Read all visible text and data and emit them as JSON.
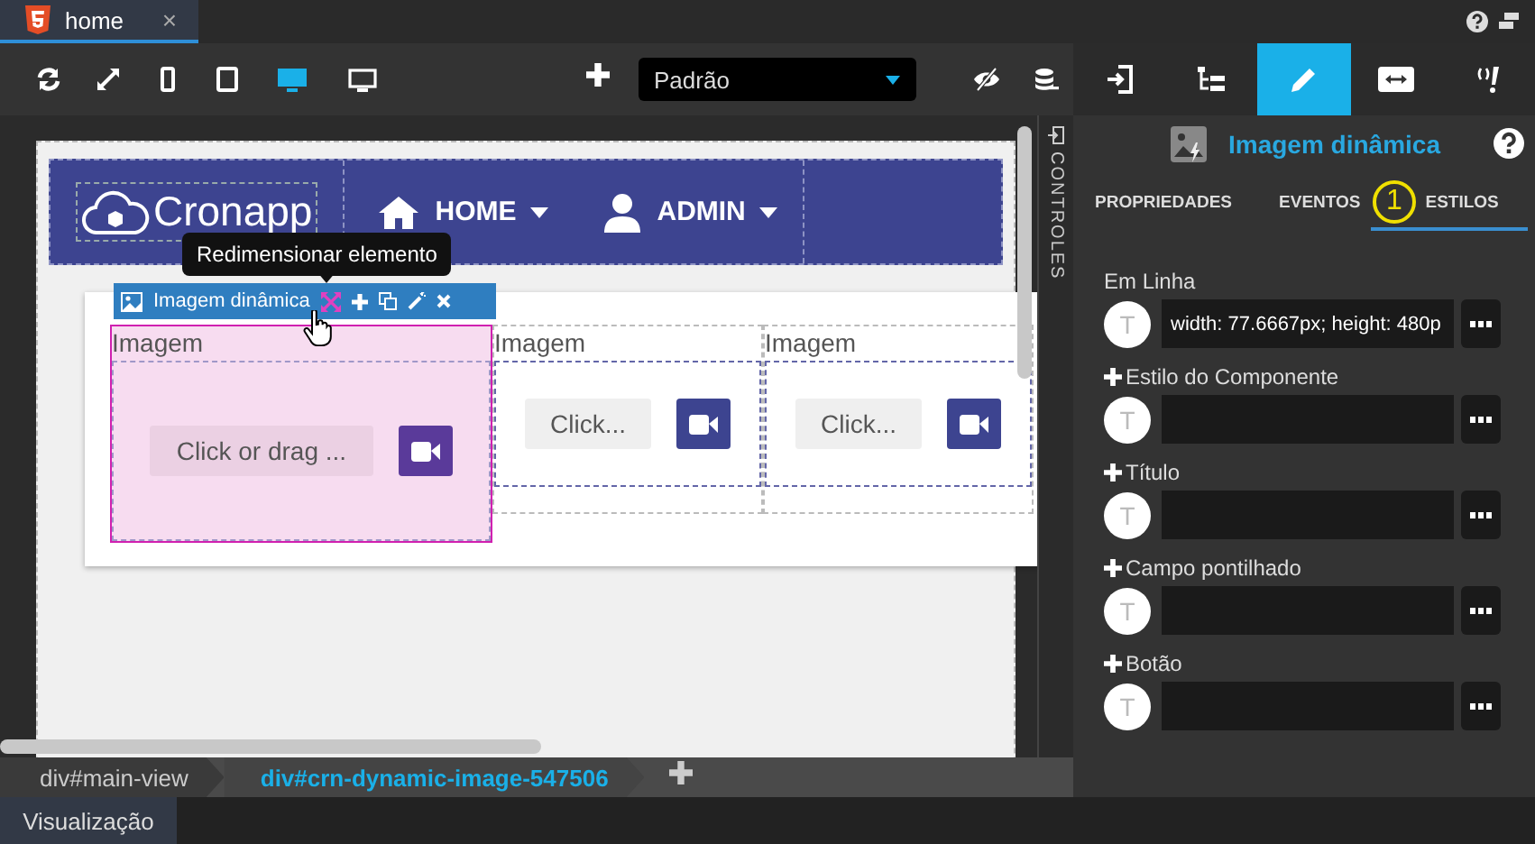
{
  "editor_tab": {
    "label": "home",
    "close": "×"
  },
  "toolbar": {
    "view_modes": [
      {
        "selected": false
      },
      {
        "selected": false
      },
      {
        "selected": true
      },
      {
        "selected": false
      }
    ],
    "theme_select": {
      "value": "Padrão"
    }
  },
  "canvas": {
    "brand": "Cronapp",
    "nav_items": [
      {
        "label": "HOME",
        "kind": "home"
      },
      {
        "label": "ADMIN",
        "kind": "user"
      }
    ],
    "tooltip": "Redimensionar elemento",
    "component_toolbar": {
      "title": "Imagem dinâmica"
    },
    "images": [
      {
        "label": "Imagem",
        "button_text": "Click or drag ...",
        "selected": true
      },
      {
        "label": "Imagem",
        "button_text": "Click...",
        "selected": false
      },
      {
        "label": "Imagem",
        "button_text": "Click...",
        "selected": false
      }
    ]
  },
  "side_strip": {
    "label": "CONTROLES"
  },
  "breadcrumbs": [
    {
      "label": "div#main-view",
      "selected": false
    },
    {
      "label": "div#crn-dynamic-image-547506",
      "selected": true
    }
  ],
  "bottom_tab": {
    "label": "Visualização"
  },
  "panel": {
    "tabs": [
      {
        "selected": false
      },
      {
        "selected": false
      },
      {
        "selected": true
      },
      {
        "selected": false
      },
      {
        "selected": false
      }
    ],
    "title": "Imagem dinâmica",
    "sub_tabs": [
      {
        "label": "PROPRIEDADES",
        "selected": false
      },
      {
        "label": "EVENTOS",
        "selected": false
      },
      {
        "label": "ESTILOS",
        "selected": true
      }
    ],
    "annotation": "1",
    "style_fields": [
      {
        "label": "Em Linha",
        "expandable": false,
        "avatar": "T",
        "value": "width: 77.6667px; height: 480p"
      },
      {
        "label": "Estilo do Componente",
        "expandable": true,
        "avatar": "T"
      },
      {
        "label": "Título",
        "expandable": true,
        "avatar": "T"
      },
      {
        "label": "Campo pontilhado",
        "expandable": true,
        "avatar": "T"
      },
      {
        "label": "Botão",
        "expandable": true,
        "avatar": "T"
      }
    ]
  }
}
